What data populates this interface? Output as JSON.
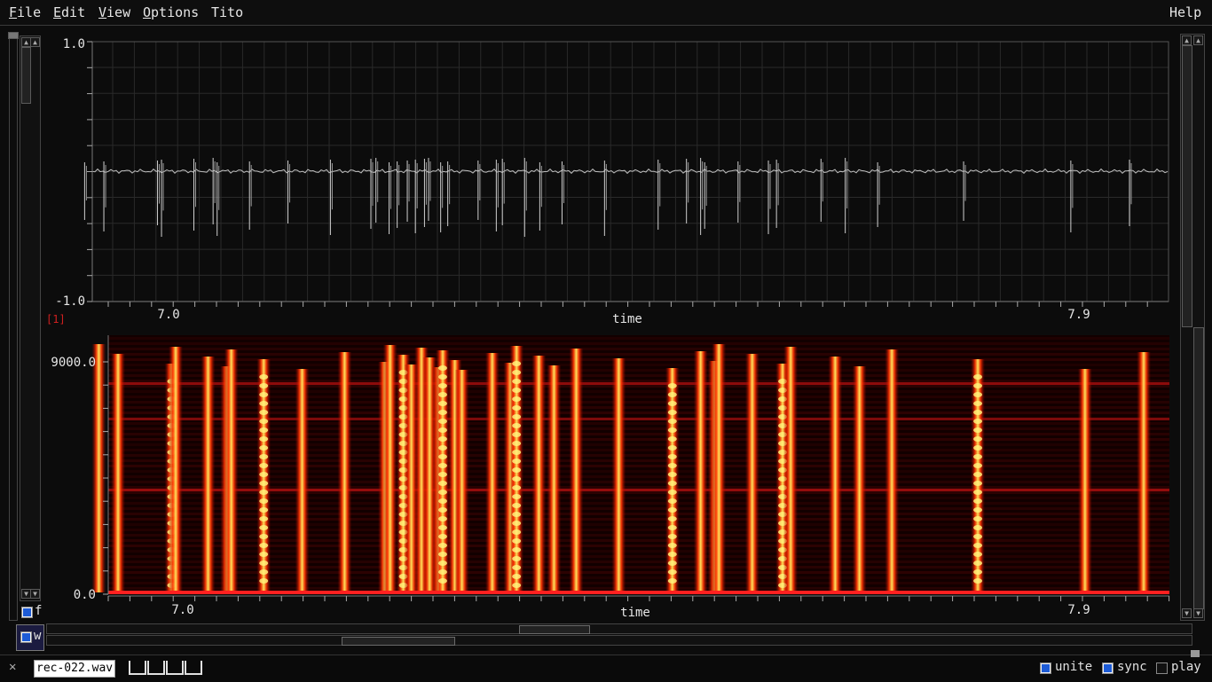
{
  "menubar": {
    "items": [
      {
        "label": "File",
        "mnemonic": "F",
        "rest": "ile"
      },
      {
        "label": "Edit",
        "mnemonic": "E",
        "rest": "dit"
      },
      {
        "label": "View",
        "mnemonic": "V",
        "rest": "iew"
      },
      {
        "label": "Options",
        "mnemonic": "O",
        "rest": "ptions"
      },
      {
        "label": "Tito",
        "mnemonic": "",
        "rest": "Tito"
      }
    ],
    "help": {
      "mnemonic": "",
      "rest": "Help"
    }
  },
  "waveform": {
    "y_top": "1.0",
    "y_bottom": "-1.0",
    "channel_marker": "[1]",
    "x_tick_left": "7.0",
    "x_tick_right": "7.9",
    "x_label": "time"
  },
  "spectrogram": {
    "y_top": "9000.0",
    "y_bottom": "0.0",
    "x_tick_left": "7.0",
    "x_tick_right": "7.9",
    "x_label": "time"
  },
  "left_controls": {
    "f_label": "f",
    "w_label": "w"
  },
  "bottombar": {
    "close_glyph": "✕",
    "file_tab": "rec-022.wav",
    "unite_label": "unite",
    "sync_label": "sync",
    "play_label": "play",
    "unite_checked": true,
    "sync_checked": true,
    "play_checked": false
  },
  "chart_data": {
    "type": "line",
    "title": "",
    "xlabel": "time",
    "ylabel": "",
    "ylim": [
      -1.0,
      1.0
    ],
    "x_ticks": [
      "7.0",
      "7.9"
    ],
    "description_series": [
      {
        "name": "",
        "click_times": [
          6.917,
          6.936,
          6.989,
          6.993,
          7.025,
          7.044,
          7.048,
          7.08,
          7.118,
          7.16,
          7.2,
          7.205,
          7.218,
          7.226,
          7.236,
          7.244,
          7.253,
          7.257,
          7.269,
          7.276,
          7.306,
          7.324,
          7.33,
          7.352,
          7.367,
          7.389,
          7.431,
          7.484,
          7.512,
          7.526,
          7.53,
          7.563,
          7.593,
          7.601,
          7.645,
          7.669,
          7.701,
          7.786,
          7.892,
          7.95
        ]
      }
    ],
    "colors": {
      "waveform": "#c8c8c8",
      "spectrogram_low": "#3a0000",
      "spectrogram_high": "#fff27a"
    }
  }
}
